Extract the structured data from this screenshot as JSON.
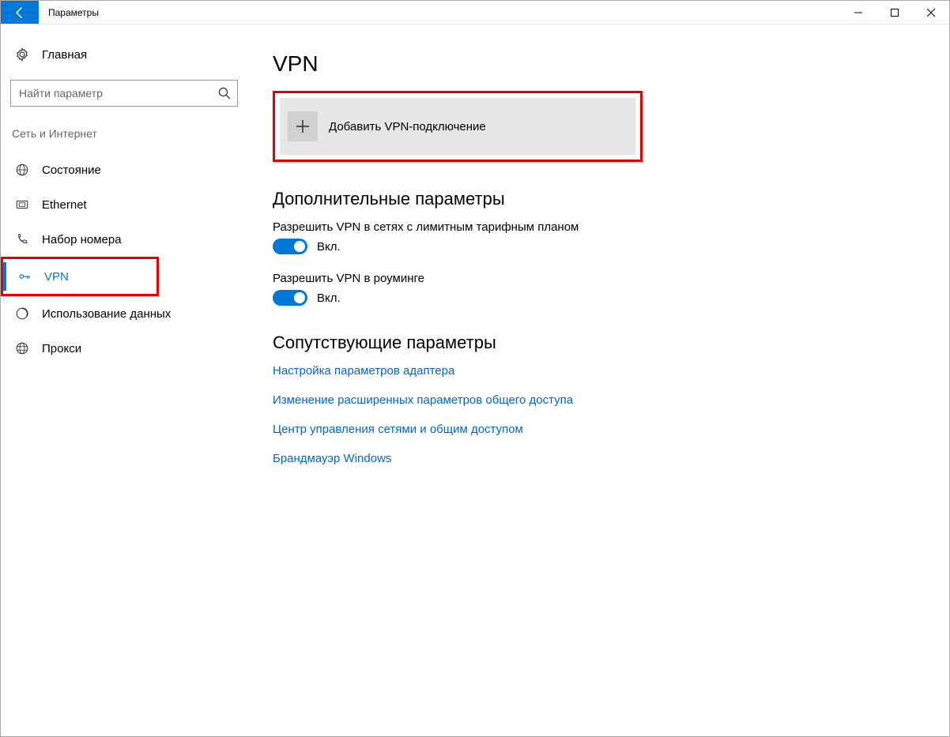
{
  "window": {
    "title": "Параметры"
  },
  "sidebar": {
    "home": "Главная",
    "search_placeholder": "Найти параметр",
    "section": "Сеть и Интернет",
    "items": [
      {
        "label": "Состояние"
      },
      {
        "label": "Ethernet"
      },
      {
        "label": "Набор номера"
      },
      {
        "label": "VPN",
        "active": true
      },
      {
        "label": "Использование данных"
      },
      {
        "label": "Прокси"
      }
    ]
  },
  "main": {
    "heading": "VPN",
    "add_button": "Добавить VPN-подключение",
    "advanced_heading": "Дополнительные параметры",
    "setting_metered": "Разрешить VPN в сетях с лимитным тарифным планом",
    "setting_roaming": "Разрешить VPN в роуминге",
    "on_label": "Вкл.",
    "related_heading": "Сопутствующие параметры",
    "links": [
      "Настройка параметров адаптера",
      "Изменение расширенных параметров общего доступа",
      "Центр управления сетями и общим доступом",
      "Брандмауэр Windows"
    ]
  }
}
